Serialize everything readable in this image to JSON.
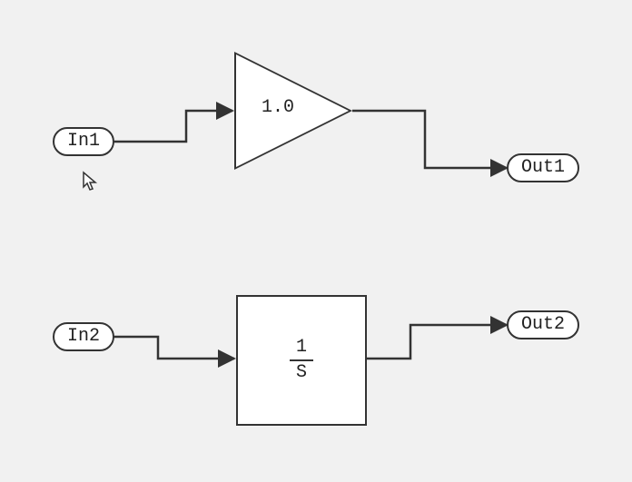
{
  "diagram": {
    "ports": {
      "in1": {
        "label": "In1"
      },
      "in2": {
        "label": "In2"
      },
      "out1": {
        "label": "Out1"
      },
      "out2": {
        "label": "Out2"
      }
    },
    "blocks": {
      "gain": {
        "type": "gain",
        "value": "1.0"
      },
      "integrator": {
        "type": "transfer_function",
        "numerator": "1",
        "denominator": "S"
      }
    },
    "connections": [
      {
        "from": "in1",
        "to": "gain"
      },
      {
        "from": "gain",
        "to": "out1"
      },
      {
        "from": "in2",
        "to": "integrator"
      },
      {
        "from": "integrator",
        "to": "out2"
      }
    ]
  }
}
